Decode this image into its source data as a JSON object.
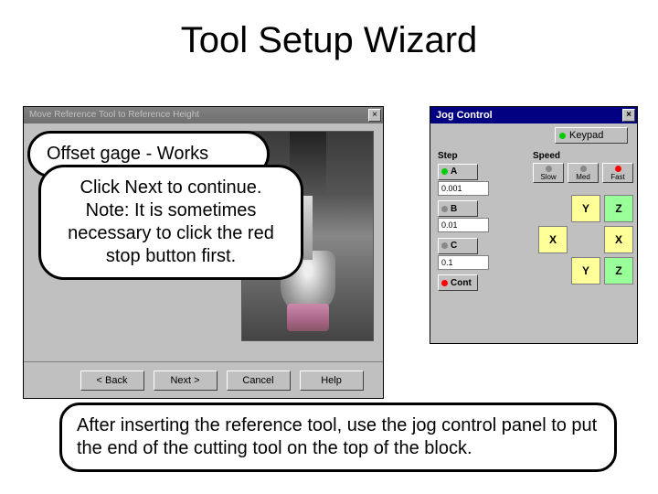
{
  "title": "Tool Setup Wizard",
  "wizard": {
    "titlebar": "Move Reference Tool to Reference Height",
    "buttons": {
      "back": "< Back",
      "next": "Next >",
      "cancel": "Cancel",
      "help": "Help"
    }
  },
  "jog": {
    "title": "Jog Control",
    "keypad": "Keypad",
    "step_label": "Step",
    "speed_label": "Speed",
    "step_a": "A",
    "step_a_val": "0.001",
    "step_b": "B",
    "step_b_val": "0.01",
    "step_c": "C",
    "step_c_val": "0.1",
    "step_cont": "Cont",
    "speed_slow": "Slow",
    "speed_med": "Med",
    "speed_fast": "Fast",
    "axis": {
      "y_up": "Y",
      "z_up": "Z",
      "x_left": "X",
      "x_right": "X",
      "y_down": "Y",
      "z_down": "Z"
    }
  },
  "bubbles": {
    "offset": "Offset gage - Works",
    "click": "Click Next to continue. Note: It is sometimes necessary to click the red stop button first.",
    "after": "After inserting the reference tool, use the jog control panel to put the end of the cutting tool on the top of the block."
  }
}
